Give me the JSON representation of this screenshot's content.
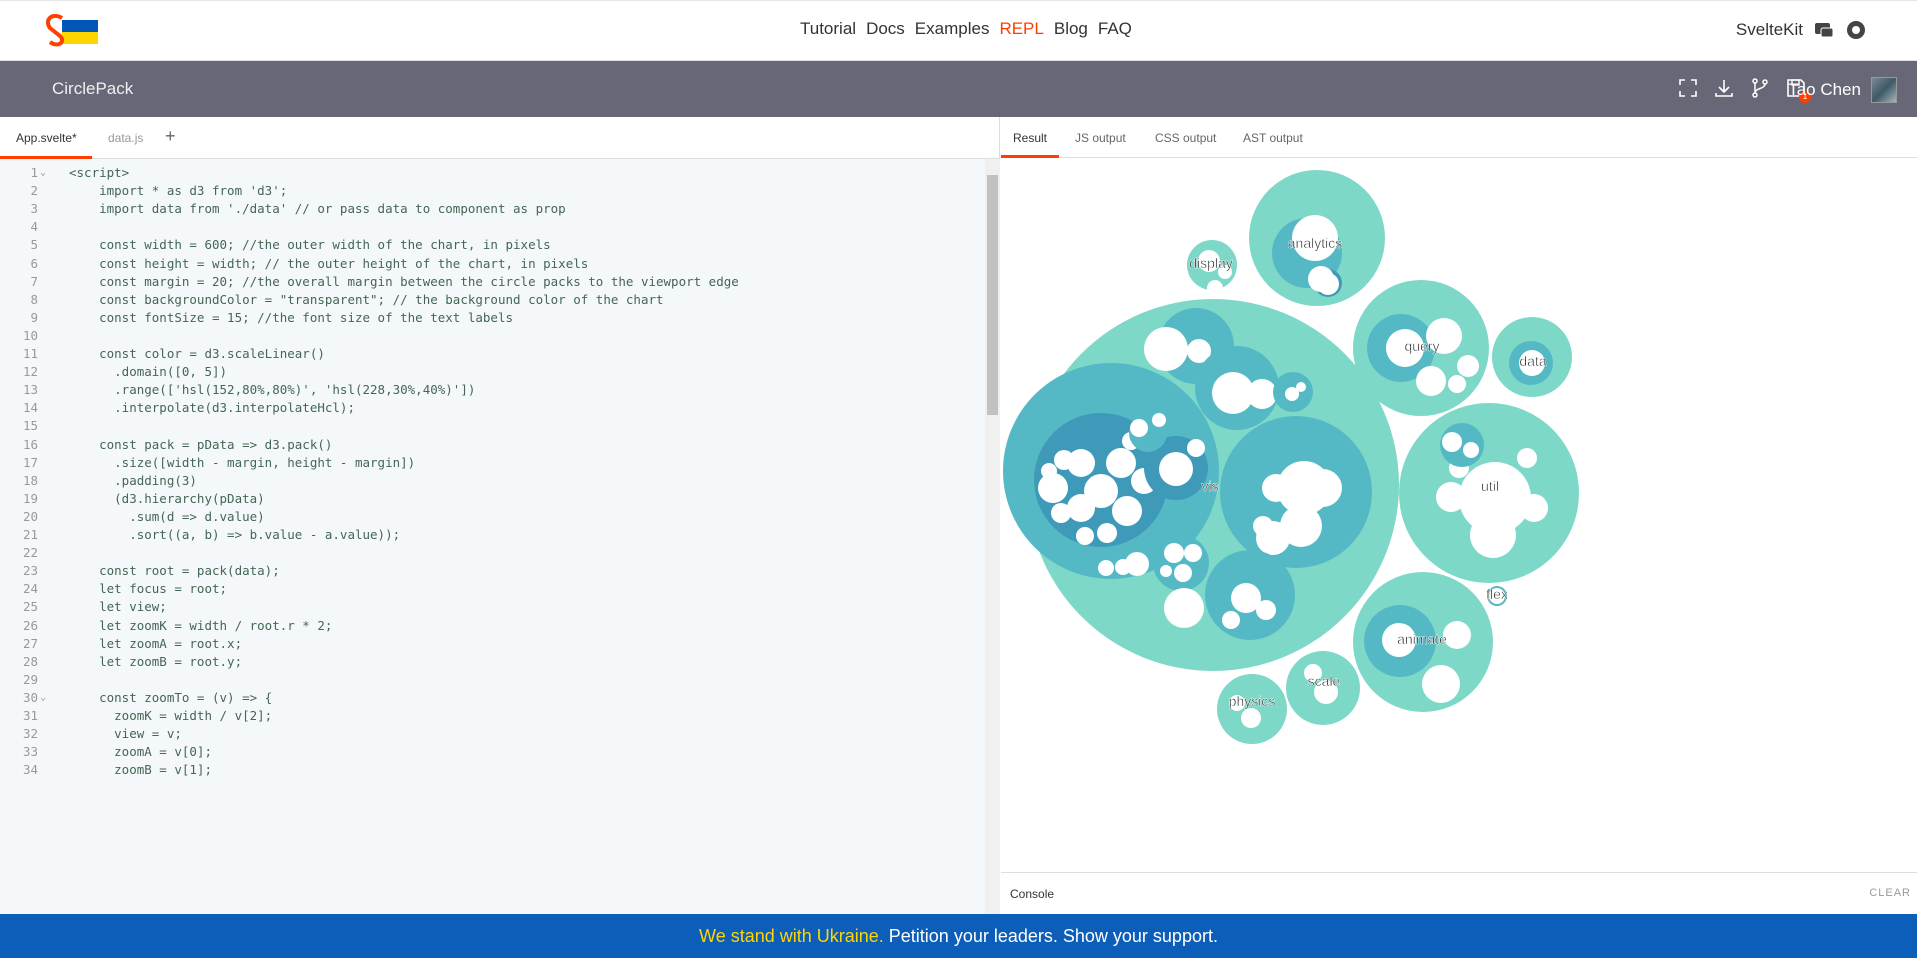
{
  "nav": {
    "links": [
      "Tutorial",
      "Docs",
      "Examples",
      "REPL",
      "Blog",
      "FAQ"
    ],
    "active": "REPL",
    "right_link": "SvelteKit"
  },
  "appbar": {
    "title": "CirclePack",
    "user": "Tao Chen",
    "save_badge": "1"
  },
  "editor": {
    "tabs": [
      "App.svelte*",
      "data.js"
    ],
    "add_tab": "+",
    "lines": [
      "<script>",
      "    import * as d3 from 'd3';",
      "    import data from './data' // or pass data to component as prop",
      "",
      "    const width = 600; //the outer width of the chart, in pixels",
      "    const height = width; // the outer height of the chart, in pixels",
      "    const margin = 20; //the overall margin between the circle packs to the viewport edge",
      "    const backgroundColor = \"transparent\"; // the background color of the chart",
      "    const fontSize = 15; //the font size of the text labels",
      "",
      "    const color = d3.scaleLinear()",
      "      .domain([0, 5])",
      "      .range(['hsl(152,80%,80%)', 'hsl(228,30%,40%)'])",
      "      .interpolate(d3.interpolateHcl);",
      "",
      "    const pack = pData => d3.pack()",
      "      .size([width - margin, height - margin])",
      "      .padding(3)",
      "      (d3.hierarchy(pData)",
      "        .sum(d => d.value)",
      "        .sort((a, b) => b.value - a.value));",
      "",
      "    const root = pack(data);",
      "    let focus = root;",
      "    let view;",
      "    let zoomK = width / root.r * 2;",
      "    let zoomA = root.x;",
      "    let zoomB = root.y;",
      "",
      "    const zoomTo = (v) => {",
      "      zoomK = width / v[2];",
      "      view = v;",
      "      zoomA = v[0];",
      "      zoomB = v[1];"
    ],
    "fold_lines": [
      1,
      30
    ]
  },
  "result": {
    "tabs": [
      "Result",
      "JS output",
      "CSS output",
      "AST output"
    ],
    "labels": [
      "display",
      "analytics",
      "query",
      "data",
      "vis",
      "util",
      "flex",
      "animate",
      "scale",
      "physics"
    ]
  },
  "console": {
    "label": "Console",
    "clear": "CLEAR"
  },
  "banner": {
    "highlight": "We stand with Ukraine.",
    "rest": " Petition your leaders. Show your support."
  },
  "colors": {
    "accent": "#ff3e00",
    "appbar": "#676778",
    "banner": "#0d5eb8",
    "banner_highlight": "#ffd500"
  }
}
